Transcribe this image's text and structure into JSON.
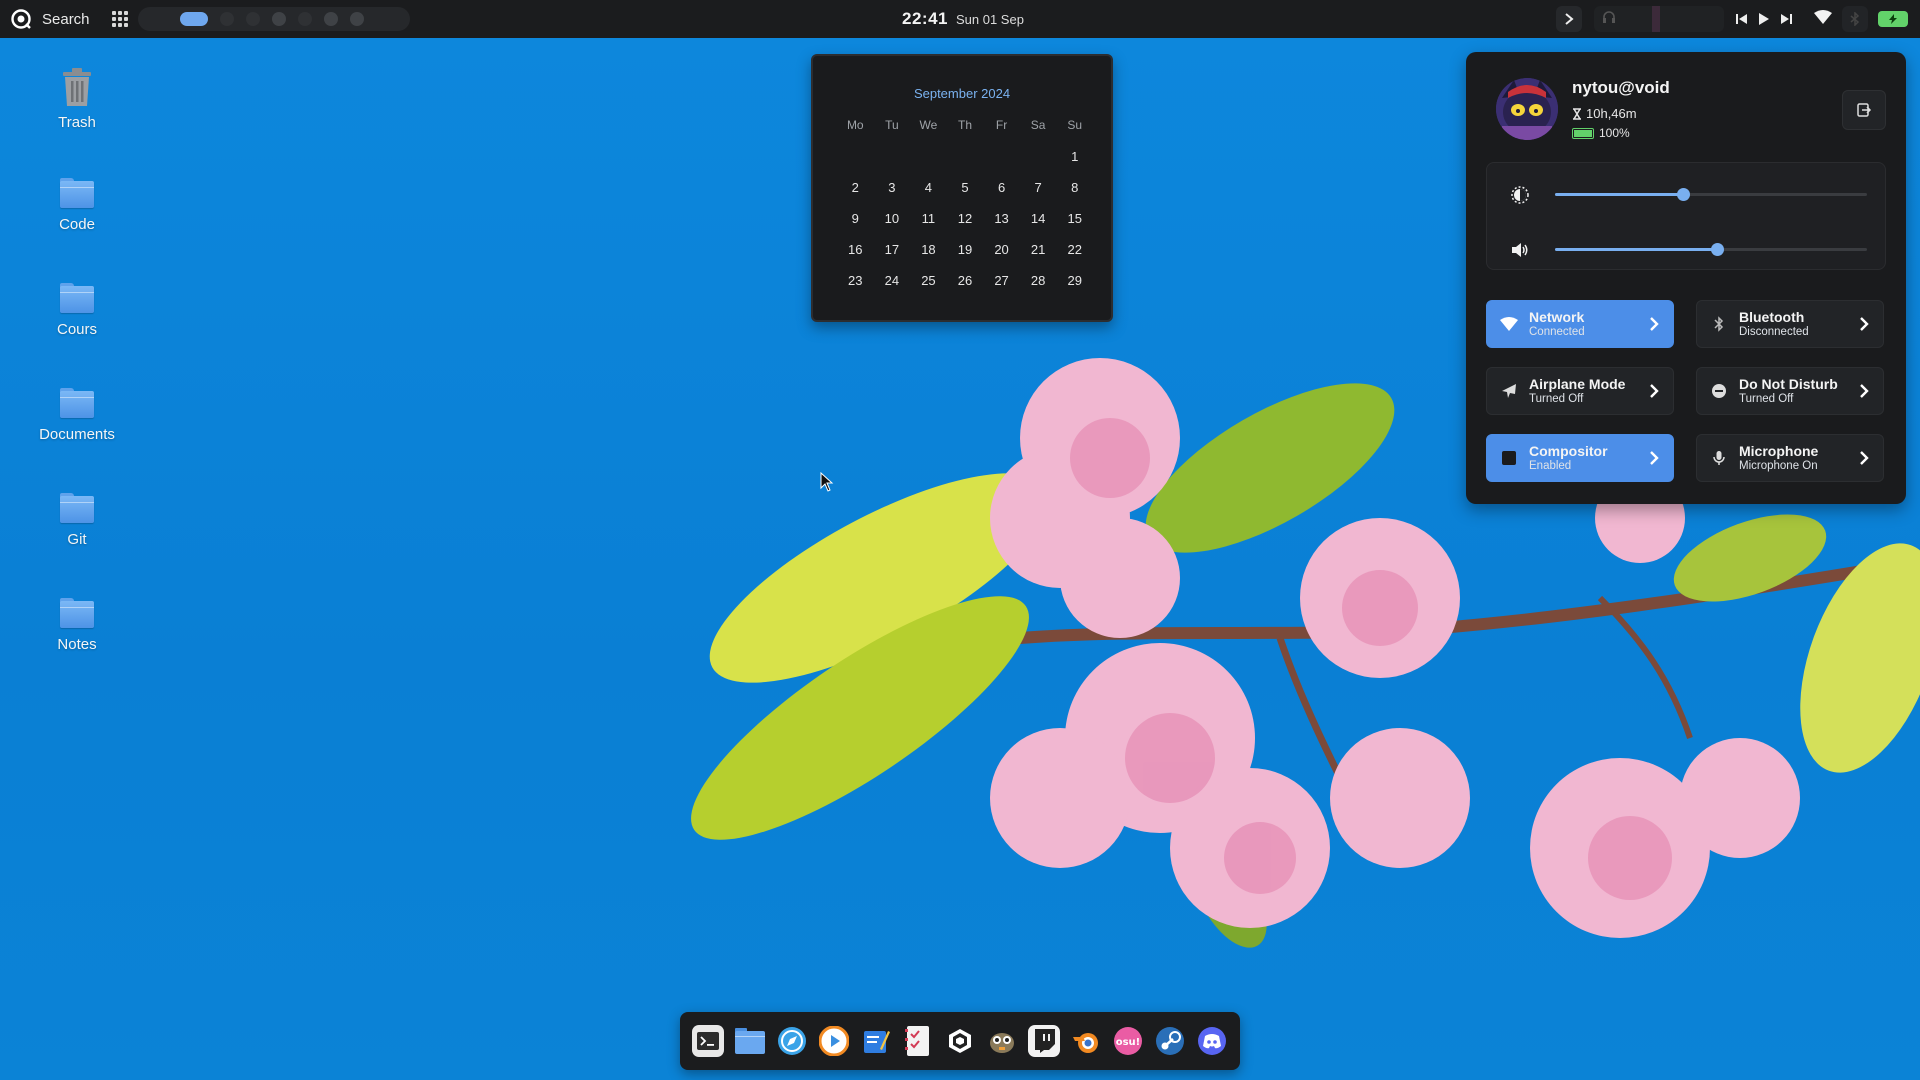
{
  "topbar": {
    "search_label": "Search",
    "time": "22:41",
    "date": "Sun 01 Sep"
  },
  "desktop": {
    "icons": [
      {
        "label": "Trash",
        "icon": "trash-icon"
      },
      {
        "label": "Code",
        "icon": "folder-icon"
      },
      {
        "label": "Cours",
        "icon": "folder-icon"
      },
      {
        "label": "Documents",
        "icon": "folder-icon"
      },
      {
        "label": "Git",
        "icon": "folder-icon"
      },
      {
        "label": "Notes",
        "icon": "folder-icon"
      }
    ]
  },
  "calendar": {
    "month": "September 2024",
    "weekdays": [
      "Mo",
      "Tu",
      "We",
      "Th",
      "Fr",
      "Sa",
      "Su"
    ],
    "days": [
      [
        "",
        "",
        "",
        "",
        "",
        "",
        "1"
      ],
      [
        "2",
        "3",
        "4",
        "5",
        "6",
        "7",
        "8"
      ],
      [
        "9",
        "10",
        "11",
        "12",
        "13",
        "14",
        "15"
      ],
      [
        "16",
        "17",
        "18",
        "19",
        "20",
        "21",
        "22"
      ],
      [
        "23",
        "24",
        "25",
        "26",
        "27",
        "28",
        "29"
      ]
    ]
  },
  "control_center": {
    "username": "nytou@void",
    "uptime": "10h,46m",
    "battery": "100%",
    "brightness_level": 0.41,
    "volume_level": 0.52,
    "tiles": [
      {
        "title": "Network",
        "status": "Connected",
        "active": true,
        "icon": "wifi-icon"
      },
      {
        "title": "Bluetooth",
        "status": "Disconnected",
        "active": false,
        "icon": "bluetooth-icon"
      },
      {
        "title": "Airplane Mode",
        "status": "Turned Off",
        "active": false,
        "icon": "airplane-icon"
      },
      {
        "title": "Do Not Disturb",
        "status": "Turned Off",
        "active": false,
        "icon": "dnd-icon"
      },
      {
        "title": "Compositor",
        "status": "Enabled",
        "active": true,
        "icon": "compositor-icon"
      },
      {
        "title": "Microphone",
        "status": "Microphone On",
        "active": false,
        "icon": "microphone-icon"
      }
    ]
  },
  "dock": {
    "apps": [
      "terminal",
      "files",
      "browser",
      "media-player",
      "text-editor",
      "tasks",
      "game-engine",
      "gimp",
      "twitch",
      "blender",
      "osu",
      "steam",
      "discord"
    ]
  },
  "colors": {
    "accent": "#4c8ee8",
    "bar_bg": "#1b1c1e",
    "wallpaper": "#0a82d8",
    "battery_green": "#62d26a"
  }
}
